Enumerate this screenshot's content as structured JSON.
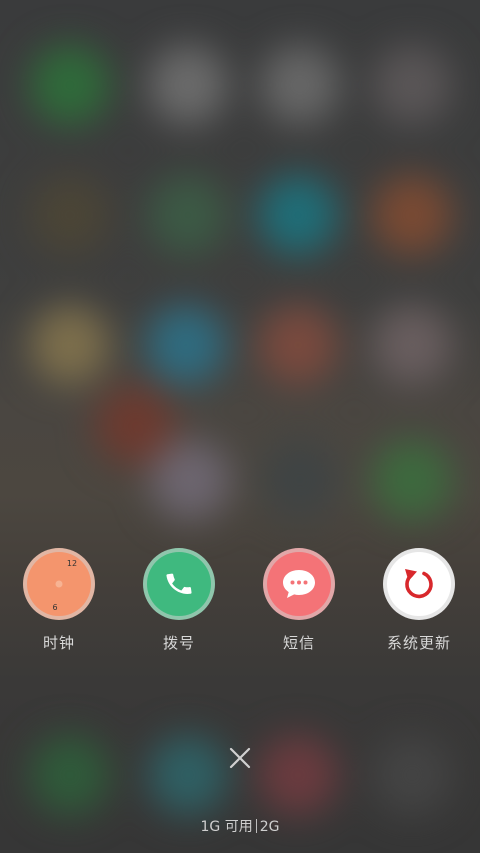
{
  "recent_apps": [
    {
      "label": "时钟",
      "icon": "clock-icon",
      "color": "#f4956d"
    },
    {
      "label": "拨号",
      "icon": "phone-icon",
      "color": "#3fb97f"
    },
    {
      "label": "短信",
      "icon": "message-icon",
      "color": "#f47377"
    },
    {
      "label": "系统更新",
      "icon": "system-update-icon",
      "color": "#ffffff"
    }
  ],
  "clock": {
    "twelve": "12",
    "six": "6"
  },
  "memory": {
    "available": "1G 可用",
    "total": "2G"
  },
  "close": {
    "icon": "close-icon"
  }
}
